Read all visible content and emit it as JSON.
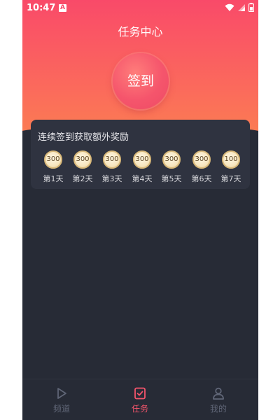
{
  "status_bar": {
    "time": "10:47",
    "notif_icon": "A"
  },
  "header": {
    "title": "任务中心"
  },
  "checkin": {
    "button_label": "签到"
  },
  "reward_card": {
    "title": "连续签到获取额外奖励",
    "days": [
      {
        "coins": "300",
        "label": "第1天"
      },
      {
        "coins": "300",
        "label": "第2天"
      },
      {
        "coins": "300",
        "label": "第3天"
      },
      {
        "coins": "300",
        "label": "第4天"
      },
      {
        "coins": "300",
        "label": "第5天"
      },
      {
        "coins": "300",
        "label": "第6天"
      },
      {
        "coins": "100",
        "label": "第7天"
      }
    ]
  },
  "bottom_nav": {
    "items": [
      {
        "label": "频道",
        "icon": "play-icon"
      },
      {
        "label": "任务",
        "icon": "task-check-icon",
        "active": true
      },
      {
        "label": "我的",
        "icon": "user-icon"
      }
    ]
  },
  "colors": {
    "accent": "#f5556c",
    "gradient_top": "#f94a69",
    "gradient_bottom": "#fb8150",
    "background": "#272b36",
    "card": "#2f3340",
    "nav_inactive": "#5f6576"
  }
}
